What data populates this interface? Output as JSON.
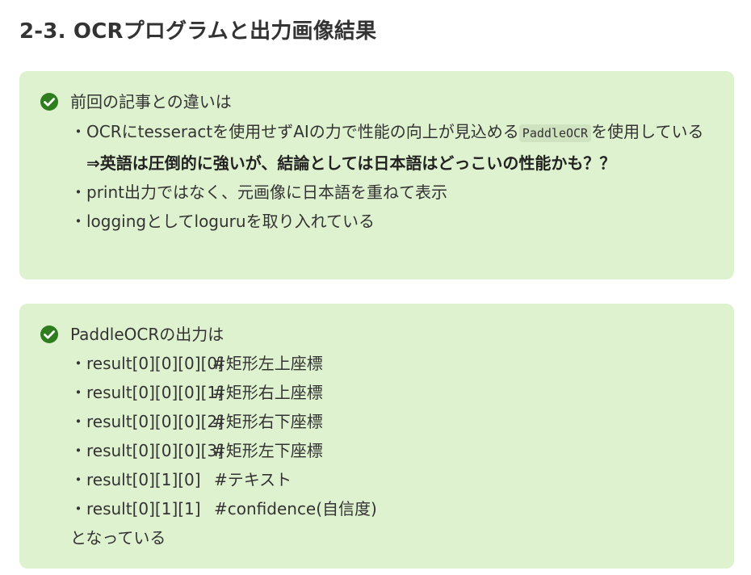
{
  "heading": "2-3. OCRプログラムと出力画像結果",
  "box1": {
    "title": "前回の記事との違いは",
    "line1_pre": "・OCRにtesseractを使用せずAIの力で性能の向上が見込める",
    "line1_code": "PaddleOCR",
    "line1_post": "を使用している",
    "line2": "⇒英語は圧倒的に強いが、結論としては日本語はどっこいの性能かも？？",
    "line3": "・print出力ではなく、元画像に日本語を重ねて表示",
    "line4": "・loggingとしてloguruを取り入れている"
  },
  "box2": {
    "title": "PaddleOCRの出力は",
    "rows": [
      {
        "key": "・result[0][0][0][0]",
        "comment": "#矩形左上座標"
      },
      {
        "key": "・result[0][0][0][1]",
        "comment": "#矩形右上座標"
      },
      {
        "key": "・result[0][0][0][2]",
        "comment": "#矩形右下座標"
      },
      {
        "key": "・result[0][0][0][3]",
        "comment": "#矩形左下座標"
      },
      {
        "key": "・result[0][1][0]",
        "comment": "#テキスト"
      },
      {
        "key": "・result[0][1][1]",
        "comment": "#confidence(自信度)"
      }
    ],
    "footer": "となっている"
  },
  "colors": {
    "box_background": "#dff2cf",
    "check_icon": "#2e7d1e",
    "heading_text": "#333333"
  }
}
